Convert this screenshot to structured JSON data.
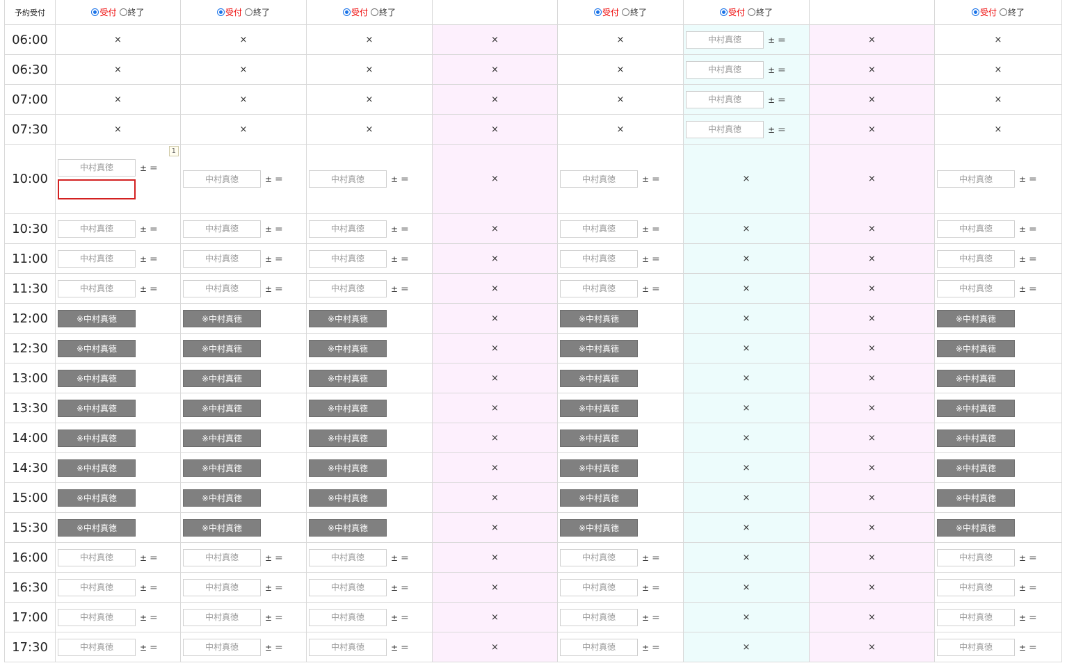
{
  "header": {
    "corner_label": "予約受付",
    "radio_on": "受付",
    "radio_off": "終了",
    "columns": [
      {
        "radios": true,
        "state": "on"
      },
      {
        "radios": true,
        "state": "on"
      },
      {
        "radios": true,
        "state": "on"
      },
      {
        "radios": false,
        "bg": "pink"
      },
      {
        "radios": true,
        "state": "on"
      },
      {
        "radios": true,
        "state": "on"
      },
      {
        "radios": false,
        "bg": "pink"
      },
      {
        "radios": true,
        "state": "on"
      }
    ]
  },
  "labels": {
    "name_placeholder": "中村真徳",
    "pm": "± ＝",
    "x": "×",
    "blocked": "※中村真徳",
    "badge": "1"
  },
  "column_backgrounds": [
    "",
    "",
    "",
    "pink",
    "",
    "cyan",
    "pink",
    ""
  ],
  "rows": [
    {
      "time": "06:00",
      "cells": [
        "x",
        "x",
        "x",
        "x",
        "x",
        "input",
        "x",
        "x"
      ]
    },
    {
      "time": "06:30",
      "cells": [
        "x",
        "x",
        "x",
        "x",
        "x",
        "input",
        "x",
        "x"
      ]
    },
    {
      "time": "07:00",
      "cells": [
        "x",
        "x",
        "x",
        "x",
        "x",
        "input",
        "x",
        "x"
      ]
    },
    {
      "time": "07:30",
      "cells": [
        "x",
        "x",
        "x",
        "x",
        "x",
        "input",
        "x",
        "x"
      ]
    },
    {
      "time": "10:00",
      "tall": true,
      "cells": [
        "input-extra",
        "input",
        "input",
        "x",
        "input",
        "x",
        "x",
        "input"
      ]
    },
    {
      "time": "10:30",
      "cells": [
        "input",
        "input",
        "input",
        "x",
        "input",
        "x",
        "x",
        "input"
      ]
    },
    {
      "time": "11:00",
      "cells": [
        "input",
        "input",
        "input",
        "x",
        "input",
        "x",
        "x",
        "input"
      ]
    },
    {
      "time": "11:30",
      "cells": [
        "input",
        "input",
        "input",
        "x",
        "input",
        "x",
        "x",
        "input"
      ]
    },
    {
      "time": "12:00",
      "cells": [
        "blocked",
        "blocked",
        "blocked",
        "x",
        "blocked",
        "x",
        "x",
        "blocked"
      ]
    },
    {
      "time": "12:30",
      "cells": [
        "blocked",
        "blocked",
        "blocked",
        "x",
        "blocked",
        "x",
        "x",
        "blocked"
      ]
    },
    {
      "time": "13:00",
      "cells": [
        "blocked",
        "blocked",
        "blocked",
        "x",
        "blocked",
        "x",
        "x",
        "blocked"
      ]
    },
    {
      "time": "13:30",
      "cells": [
        "blocked",
        "blocked",
        "blocked",
        "x",
        "blocked",
        "x",
        "x",
        "blocked"
      ]
    },
    {
      "time": "14:00",
      "cells": [
        "blocked",
        "blocked",
        "blocked",
        "x",
        "blocked",
        "x",
        "x",
        "blocked"
      ]
    },
    {
      "time": "14:30",
      "cells": [
        "blocked",
        "blocked",
        "blocked",
        "x",
        "blocked",
        "x",
        "x",
        "blocked"
      ]
    },
    {
      "time": "15:00",
      "cells": [
        "blocked",
        "blocked",
        "blocked",
        "x",
        "blocked",
        "x",
        "x",
        "blocked"
      ]
    },
    {
      "time": "15:30",
      "cells": [
        "blocked",
        "blocked",
        "blocked",
        "x",
        "blocked",
        "x",
        "x",
        "blocked"
      ]
    },
    {
      "time": "16:00",
      "cells": [
        "input",
        "input",
        "input",
        "x",
        "input",
        "x",
        "x",
        "input"
      ]
    },
    {
      "time": "16:30",
      "cells": [
        "input",
        "input",
        "input",
        "x",
        "input",
        "x",
        "x",
        "input"
      ]
    },
    {
      "time": "17:00",
      "cells": [
        "input",
        "input",
        "input",
        "x",
        "input",
        "x",
        "x",
        "input"
      ]
    },
    {
      "time": "17:30",
      "cells": [
        "input",
        "input",
        "input",
        "x",
        "input",
        "x",
        "x",
        "input"
      ]
    }
  ]
}
